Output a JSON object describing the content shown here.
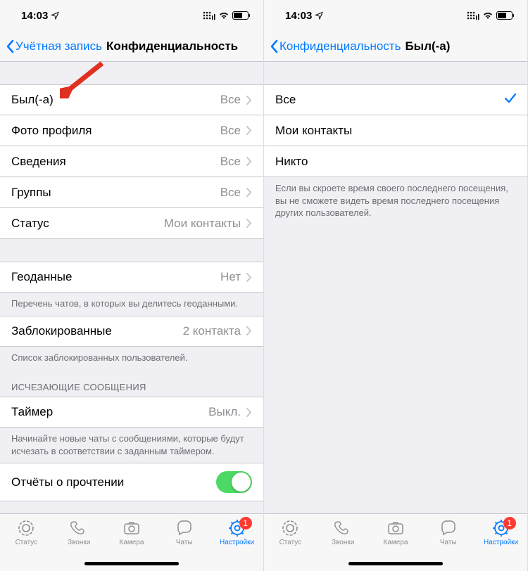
{
  "statusBar": {
    "time": "14:03"
  },
  "left": {
    "nav": {
      "back": "Учётная запись",
      "title": "Конфиденциальность"
    },
    "group1": [
      {
        "label": "Был(-а)",
        "value": "Все"
      },
      {
        "label": "Фото профиля",
        "value": "Все"
      },
      {
        "label": "Сведения",
        "value": "Все"
      },
      {
        "label": "Группы",
        "value": "Все"
      },
      {
        "label": "Статус",
        "value": "Мои контакты"
      }
    ],
    "geo": {
      "label": "Геоданные",
      "value": "Нет",
      "footer": "Перечень чатов, в которых вы делитесь геоданными."
    },
    "blocked": {
      "label": "Заблокированные",
      "value": "2 контакта",
      "footer": "Список заблокированных пользователей."
    },
    "disappearing": {
      "header": "ИСЧЕЗАЮЩИЕ СООБЩЕНИЯ",
      "label": "Таймер",
      "value": "Выкл.",
      "footer": "Начинайте новые чаты с сообщениями, которые будут исчезать в соответствии с заданным таймером."
    },
    "readReceipts": {
      "label": "Отчёты о прочтении"
    }
  },
  "right": {
    "nav": {
      "back": "Конфиденциальность",
      "title": "Был(-а)"
    },
    "options": [
      {
        "label": "Все",
        "selected": true
      },
      {
        "label": "Мои контакты",
        "selected": false
      },
      {
        "label": "Никто",
        "selected": false
      }
    ],
    "footer": "Если вы скроете время своего последнего посещения, вы не сможете видеть время последнего посещения других пользователей."
  },
  "tabs": {
    "items": [
      {
        "label": "Статус"
      },
      {
        "label": "Звонки"
      },
      {
        "label": "Камера"
      },
      {
        "label": "Чаты"
      },
      {
        "label": "Настройки"
      }
    ],
    "badge": "1"
  }
}
